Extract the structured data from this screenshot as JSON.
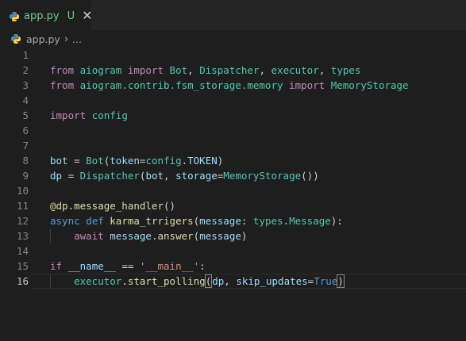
{
  "tab": {
    "filename": "app.py",
    "status": "U",
    "close": "✕"
  },
  "breadcrumb": {
    "file": "app.py",
    "sep": "›",
    "more": "..."
  },
  "lines": [
    {
      "n": "1",
      "tokens": []
    },
    {
      "n": "2",
      "tokens": [
        {
          "c": "kc",
          "t": "from"
        },
        {
          "c": "p",
          "t": " "
        },
        {
          "c": "t",
          "t": "aiogram"
        },
        {
          "c": "p",
          "t": " "
        },
        {
          "c": "kc",
          "t": "import"
        },
        {
          "c": "p",
          "t": " "
        },
        {
          "c": "t",
          "t": "Bot"
        },
        {
          "c": "p",
          "t": ", "
        },
        {
          "c": "t",
          "t": "Dispatcher"
        },
        {
          "c": "p",
          "t": ", "
        },
        {
          "c": "t",
          "t": "executor"
        },
        {
          "c": "p",
          "t": ", "
        },
        {
          "c": "t",
          "t": "types"
        }
      ]
    },
    {
      "n": "3",
      "tokens": [
        {
          "c": "kc",
          "t": "from"
        },
        {
          "c": "p",
          "t": " "
        },
        {
          "c": "t",
          "t": "aiogram.contrib.fsm_storage.memory"
        },
        {
          "c": "p",
          "t": " "
        },
        {
          "c": "kc",
          "t": "import"
        },
        {
          "c": "p",
          "t": " "
        },
        {
          "c": "t",
          "t": "MemoryStorage"
        }
      ]
    },
    {
      "n": "4",
      "tokens": []
    },
    {
      "n": "5",
      "tokens": [
        {
          "c": "kc",
          "t": "import"
        },
        {
          "c": "p",
          "t": " "
        },
        {
          "c": "t",
          "t": "config"
        }
      ]
    },
    {
      "n": "6",
      "tokens": []
    },
    {
      "n": "7",
      "tokens": []
    },
    {
      "n": "8",
      "tokens": [
        {
          "c": "v",
          "t": "bot"
        },
        {
          "c": "p",
          "t": " = "
        },
        {
          "c": "t",
          "t": "Bot"
        },
        {
          "c": "p",
          "t": "("
        },
        {
          "c": "v",
          "t": "token"
        },
        {
          "c": "p",
          "t": "="
        },
        {
          "c": "t",
          "t": "config"
        },
        {
          "c": "p",
          "t": "."
        },
        {
          "c": "v",
          "t": "TOKEN"
        },
        {
          "c": "p",
          "t": ")"
        }
      ]
    },
    {
      "n": "9",
      "tokens": [
        {
          "c": "v",
          "t": "dp"
        },
        {
          "c": "p",
          "t": " = "
        },
        {
          "c": "t",
          "t": "Dispatcher"
        },
        {
          "c": "p",
          "t": "("
        },
        {
          "c": "v",
          "t": "bot"
        },
        {
          "c": "p",
          "t": ", "
        },
        {
          "c": "v",
          "t": "storage"
        },
        {
          "c": "p",
          "t": "="
        },
        {
          "c": "t",
          "t": "MemoryStorage"
        },
        {
          "c": "p",
          "t": "())"
        }
      ]
    },
    {
      "n": "10",
      "tokens": []
    },
    {
      "n": "11",
      "tokens": [
        {
          "c": "f",
          "t": "@dp.message_handler"
        },
        {
          "c": "p",
          "t": "()"
        }
      ]
    },
    {
      "n": "12",
      "tokens": [
        {
          "c": "k",
          "t": "async"
        },
        {
          "c": "p",
          "t": " "
        },
        {
          "c": "k",
          "t": "def"
        },
        {
          "c": "p",
          "t": " "
        },
        {
          "c": "f",
          "t": "karma_trrigers"
        },
        {
          "c": "p",
          "t": "("
        },
        {
          "c": "v",
          "t": "message"
        },
        {
          "c": "p",
          "t": ": "
        },
        {
          "c": "t",
          "t": "types"
        },
        {
          "c": "p",
          "t": "."
        },
        {
          "c": "t",
          "t": "Message"
        },
        {
          "c": "p",
          "t": "):"
        }
      ]
    },
    {
      "n": "13",
      "indent": true,
      "tokens": [
        {
          "c": "p",
          "t": "    "
        },
        {
          "c": "kc",
          "t": "await"
        },
        {
          "c": "p",
          "t": " "
        },
        {
          "c": "v",
          "t": "message"
        },
        {
          "c": "p",
          "t": "."
        },
        {
          "c": "f",
          "t": "answer"
        },
        {
          "c": "p",
          "t": "("
        },
        {
          "c": "v",
          "t": "message"
        },
        {
          "c": "p",
          "t": ")"
        }
      ]
    },
    {
      "n": "14",
      "tokens": []
    },
    {
      "n": "15",
      "tokens": [
        {
          "c": "kc",
          "t": "if"
        },
        {
          "c": "p",
          "t": " "
        },
        {
          "c": "v",
          "t": "__name__"
        },
        {
          "c": "p",
          "t": " == "
        },
        {
          "c": "s",
          "t": "'__main__'"
        },
        {
          "c": "p",
          "t": ":"
        }
      ]
    },
    {
      "n": "16",
      "indent": true,
      "current": true,
      "tokens": [
        {
          "c": "p",
          "t": "    "
        },
        {
          "c": "t",
          "t": "executor"
        },
        {
          "c": "p",
          "t": "."
        },
        {
          "c": "f",
          "t": "start_polling"
        },
        {
          "c": "p bm",
          "t": "("
        },
        {
          "c": "cursor",
          "t": ""
        },
        {
          "c": "v",
          "t": "dp"
        },
        {
          "c": "p",
          "t": ", "
        },
        {
          "c": "v",
          "t": "skip_updates"
        },
        {
          "c": "p",
          "t": "="
        },
        {
          "c": "k",
          "t": "True"
        },
        {
          "c": "p bm",
          "t": ")"
        }
      ]
    }
  ]
}
